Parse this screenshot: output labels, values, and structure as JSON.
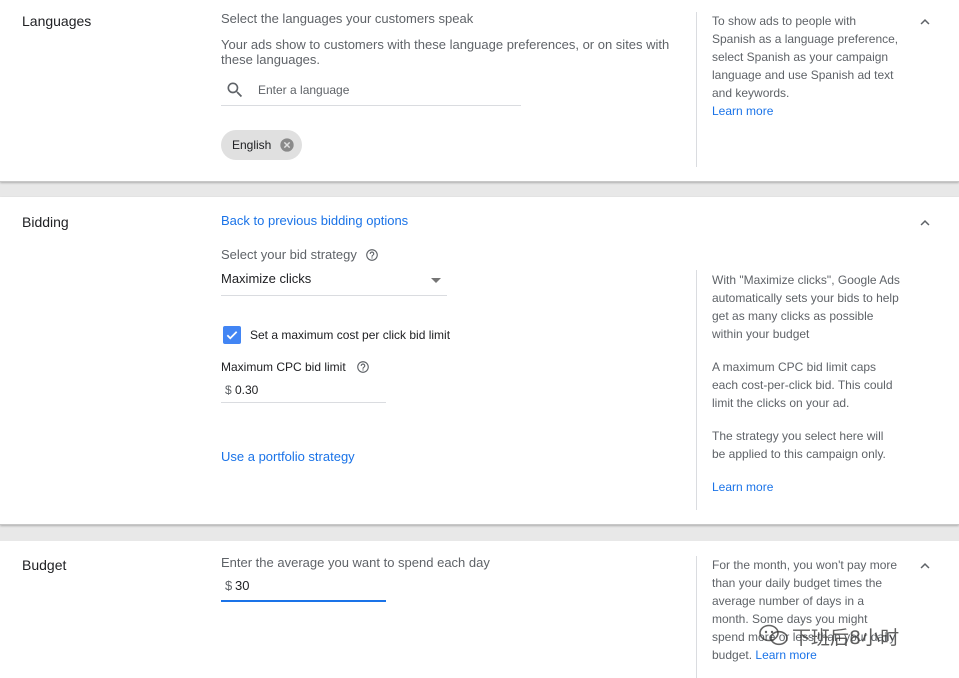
{
  "languages": {
    "title": "Languages",
    "prompt": "Select the languages your customers speak",
    "description": "Your ads show to customers with these language preferences, or on sites with these languages.",
    "search_placeholder": "Enter a language",
    "selected": [
      "English"
    ],
    "help_text": "To show ads to people with Spanish as a language preference, select Spanish as your campaign language and use Spanish ad text and keywords.",
    "help_link": "Learn more"
  },
  "bidding": {
    "title": "Bidding",
    "back_link": "Back to previous bidding options",
    "strategy_label": "Select your bid strategy",
    "strategy_value": "Maximize clicks",
    "max_cpc_checkbox_label": "Set a maximum cost per click bid limit",
    "max_cpc_checked": true,
    "max_cpc_label": "Maximum CPC bid limit",
    "currency_symbol": "$",
    "max_cpc_value": "0.30",
    "portfolio_link": "Use a portfolio strategy",
    "help_p1": "With \"Maximize clicks\", Google Ads automatically sets your bids to help get as many clicks as possible within your budget",
    "help_p2": "A maximum CPC bid limit caps each cost-per-click bid. This could limit the clicks on your ad.",
    "help_p3": "The strategy you select here will be applied to this campaign only.",
    "help_link": "Learn more"
  },
  "budget": {
    "title": "Budget",
    "prompt": "Enter the average you want to spend each day",
    "currency_symbol": "$",
    "value": "30",
    "help_text": "For the month, you won't pay more than your daily budget times the average number of days in a month. Some days you might spend more or less than your daily budget.",
    "help_link": "Learn more"
  },
  "watermark": {
    "text": "下班后8小时"
  },
  "colors": {
    "link": "#1a73e8",
    "checkbox": "#4285f4",
    "muted_text": "#5f6368"
  }
}
